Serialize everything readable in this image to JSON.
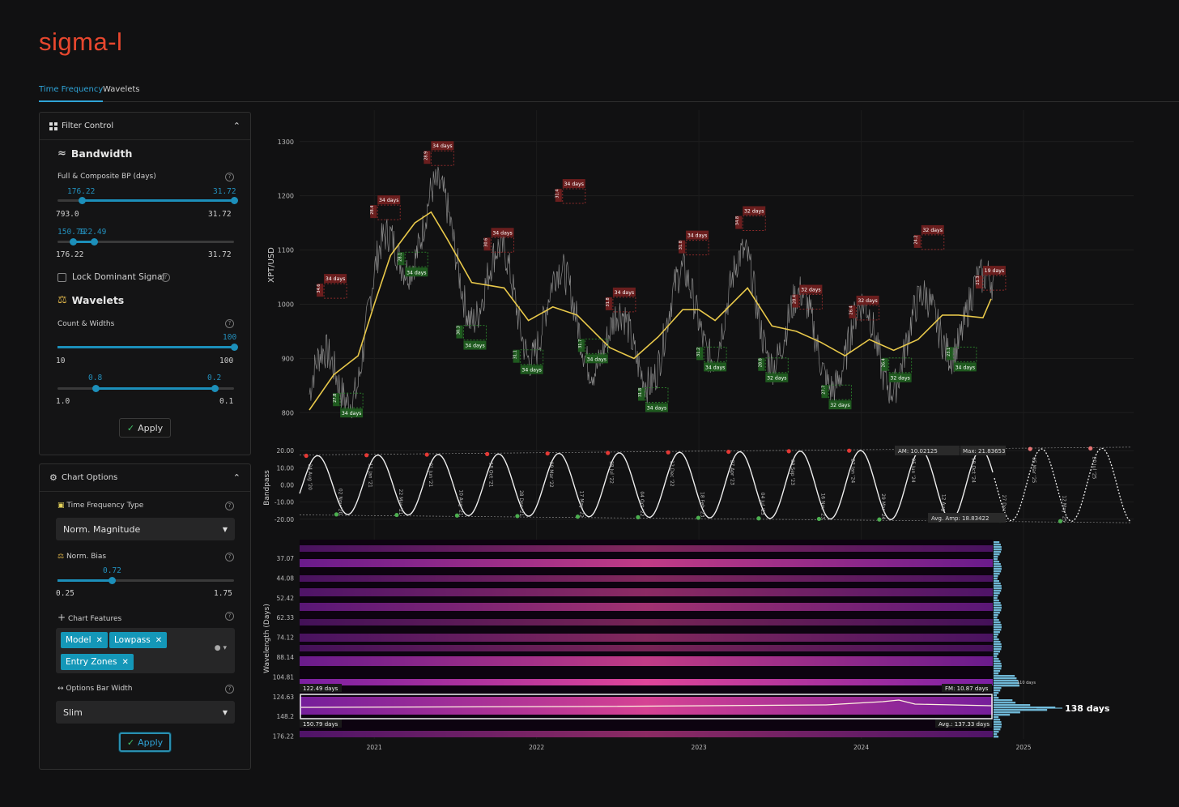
{
  "app": {
    "logo": "sigma-l"
  },
  "tabs": [
    {
      "label": "Time Frequency",
      "active": true
    },
    {
      "label": "Wavelets",
      "active": false
    }
  ],
  "filter_control": {
    "title": "Filter Control",
    "bandwidth": {
      "title": "Bandwidth",
      "label": "Full & Composite BP (days)",
      "slider1": {
        "low": "176.22",
        "high": "31.72",
        "min": "793.0",
        "max": "31.72",
        "low_frac": 0.14,
        "high_frac": 1.0
      },
      "slider2": {
        "low": "150.79",
        "high": "122.49",
        "min": "176.22",
        "max": "31.72",
        "low_frac": 0.09,
        "high_frac": 0.21
      }
    },
    "lock_label": "Lock Dominant Signal",
    "wavelets": {
      "title": "Wavelets",
      "label": "Count & Widths",
      "slider1": {
        "value": "100",
        "min": "10",
        "max": "100",
        "frac": 1.0
      },
      "slider2": {
        "low": "0.8",
        "high": "0.2",
        "min": "1.0",
        "max": "0.1",
        "low_frac": 0.22,
        "high_frac": 0.89
      }
    },
    "apply": "Apply"
  },
  "chart_options": {
    "title": "Chart Options",
    "tf_type": {
      "label": "Time Frequency Type",
      "value": "Norm. Magnitude"
    },
    "norm_bias": {
      "label": "Norm. Bias",
      "value": "0.72",
      "min": "0.25",
      "max": "1.75",
      "frac": 0.31
    },
    "features": {
      "label": "Chart Features",
      "chips": [
        "Model",
        "Lowpass",
        "Entry Zones"
      ]
    },
    "bar_width": {
      "label": "Options Bar Width",
      "value": "Slim"
    },
    "apply": "Apply"
  },
  "colors": {
    "accent": "#1c8fba",
    "logo": "#e8472e",
    "peak": "#e53935",
    "trough": "#4caf50",
    "lowpass": "#e8c84a"
  },
  "chart_data": [
    {
      "type": "line",
      "ylabel": "XPT/USD",
      "yticks": [
        800,
        900,
        1000,
        1100,
        1200,
        1300
      ],
      "ylim": [
        790,
        1340
      ],
      "x_years": [
        "2021",
        "2022",
        "2023",
        "2024",
        "2025"
      ],
      "lowpass": [
        [
          2020.6,
          805
        ],
        [
          2020.75,
          870
        ],
        [
          2020.9,
          905
        ],
        [
          2021.0,
          1000
        ],
        [
          2021.1,
          1090
        ],
        [
          2021.25,
          1150
        ],
        [
          2021.35,
          1170
        ],
        [
          2021.45,
          1120
        ],
        [
          2021.6,
          1040
        ],
        [
          2021.8,
          1030
        ],
        [
          2021.95,
          970
        ],
        [
          2022.1,
          995
        ],
        [
          2022.25,
          980
        ],
        [
          2022.45,
          920
        ],
        [
          2022.6,
          900
        ],
        [
          2022.75,
          940
        ],
        [
          2022.9,
          990
        ],
        [
          2023.0,
          990
        ],
        [
          2023.1,
          970
        ],
        [
          2023.3,
          1030
        ],
        [
          2023.45,
          960
        ],
        [
          2023.6,
          950
        ],
        [
          2023.75,
          930
        ],
        [
          2023.9,
          905
        ],
        [
          2024.05,
          935
        ],
        [
          2024.2,
          915
        ],
        [
          2024.35,
          935
        ],
        [
          2024.5,
          980
        ],
        [
          2024.6,
          980
        ],
        [
          2024.75,
          975
        ],
        [
          2024.8,
          1010
        ]
      ],
      "peaks": [
        {
          "x": 2020.72,
          "y": 1005,
          "label": "34 days",
          "sub": "34.6"
        },
        {
          "x": 2021.05,
          "y": 1150,
          "label": "34 days",
          "sub": "28.4"
        },
        {
          "x": 2021.38,
          "y": 1250,
          "label": "34 days",
          "sub": "28.9"
        },
        {
          "x": 2021.75,
          "y": 1090,
          "label": "34 days",
          "sub": "30.6"
        },
        {
          "x": 2022.19,
          "y": 1180,
          "label": "34 days",
          "sub": "31.4"
        },
        {
          "x": 2022.5,
          "y": 980,
          "label": "34 days",
          "sub": "31.8"
        },
        {
          "x": 2022.95,
          "y": 1085,
          "label": "34 days",
          "sub": "31.8"
        },
        {
          "x": 2023.3,
          "y": 1130,
          "label": "32 days",
          "sub": "34.8"
        },
        {
          "x": 2023.65,
          "y": 985,
          "label": "32 days",
          "sub": "28.4"
        },
        {
          "x": 2024.0,
          "y": 965,
          "label": "32 days",
          "sub": "26.4"
        },
        {
          "x": 2024.4,
          "y": 1095,
          "label": "32 days",
          "sub": "24.2"
        },
        {
          "x": 2024.78,
          "y": 1020,
          "label": "19 days",
          "sub": "21.3"
        }
      ],
      "troughs": [
        {
          "x": 2020.82,
          "y": 830,
          "label": "34 days",
          "sub": "27.8"
        },
        {
          "x": 2021.22,
          "y": 1090,
          "label": "34 days",
          "sub": "28.1"
        },
        {
          "x": 2021.58,
          "y": 955,
          "label": "34 days",
          "sub": "30.3"
        },
        {
          "x": 2021.93,
          "y": 910,
          "label": "34 days",
          "sub": "31.1"
        },
        {
          "x": 2022.33,
          "y": 930,
          "label": "34 days",
          "sub": "31.7"
        },
        {
          "x": 2022.7,
          "y": 840,
          "label": "34 days",
          "sub": "31.8"
        },
        {
          "x": 2023.06,
          "y": 915,
          "label": "34 days",
          "sub": "31.2"
        },
        {
          "x": 2023.44,
          "y": 895,
          "label": "32 days",
          "sub": "28.8"
        },
        {
          "x": 2023.83,
          "y": 845,
          "label": "32 days",
          "sub": "27.7"
        },
        {
          "x": 2024.2,
          "y": 895,
          "label": "32 days",
          "sub": "26.4"
        },
        {
          "x": 2024.6,
          "y": 915,
          "label": "34 days",
          "sub": "23.1"
        }
      ]
    },
    {
      "type": "line",
      "ylabel": "Bandpass",
      "yticks": [
        "20.00",
        "10.00",
        "0.00",
        "-10.00",
        "-20.00"
      ],
      "ylim": [
        -22,
        22
      ],
      "am": "AM: 10.02125",
      "max": "Max: 21.83653",
      "avg_amp": "Avg. Amp: 18.83422",
      "peak_labels": [
        "24 Aug '20",
        "11 Jan '21",
        "01 Jun '21",
        "18 Oct '21",
        "09 Mar '22",
        "28 Jul '22",
        "12 Dec '22",
        "27 Apr '23",
        "09 Sep '23",
        "22 Jan '24",
        "05 Jun '24",
        "19 Oct '24",
        "05 Mar '25",
        "20 Jul '25"
      ],
      "trough_labels": [
        "02 Nov '20",
        "22 Mar '21",
        "10 Aug '21",
        "28 Dec '21",
        "17 May '22",
        "04 Oct '22",
        "18 Feb '23",
        "04 Jul '23",
        "16 Nov '23",
        "29 Mar '24",
        "12 Aug '24",
        "27 Dec '24",
        "12 May '25"
      ]
    },
    {
      "type": "heatmap",
      "ylabel": "Wavelength (Days)",
      "yticks": [
        "37.07",
        "44.08",
        "52.42",
        "62.33",
        "74.12",
        "88.14",
        "104.81",
        "124.63",
        "148.2",
        "176.22"
      ],
      "xticks": [
        "2021",
        "2022",
        "2023",
        "2024",
        "2025"
      ],
      "band_high": "122.49 days",
      "band_low": "150.79 days",
      "fm": "FM: 10.87 days",
      "avg": "Avg.: 137.33 days",
      "dominant": "138 days",
      "small_peak": "110 days"
    }
  ]
}
